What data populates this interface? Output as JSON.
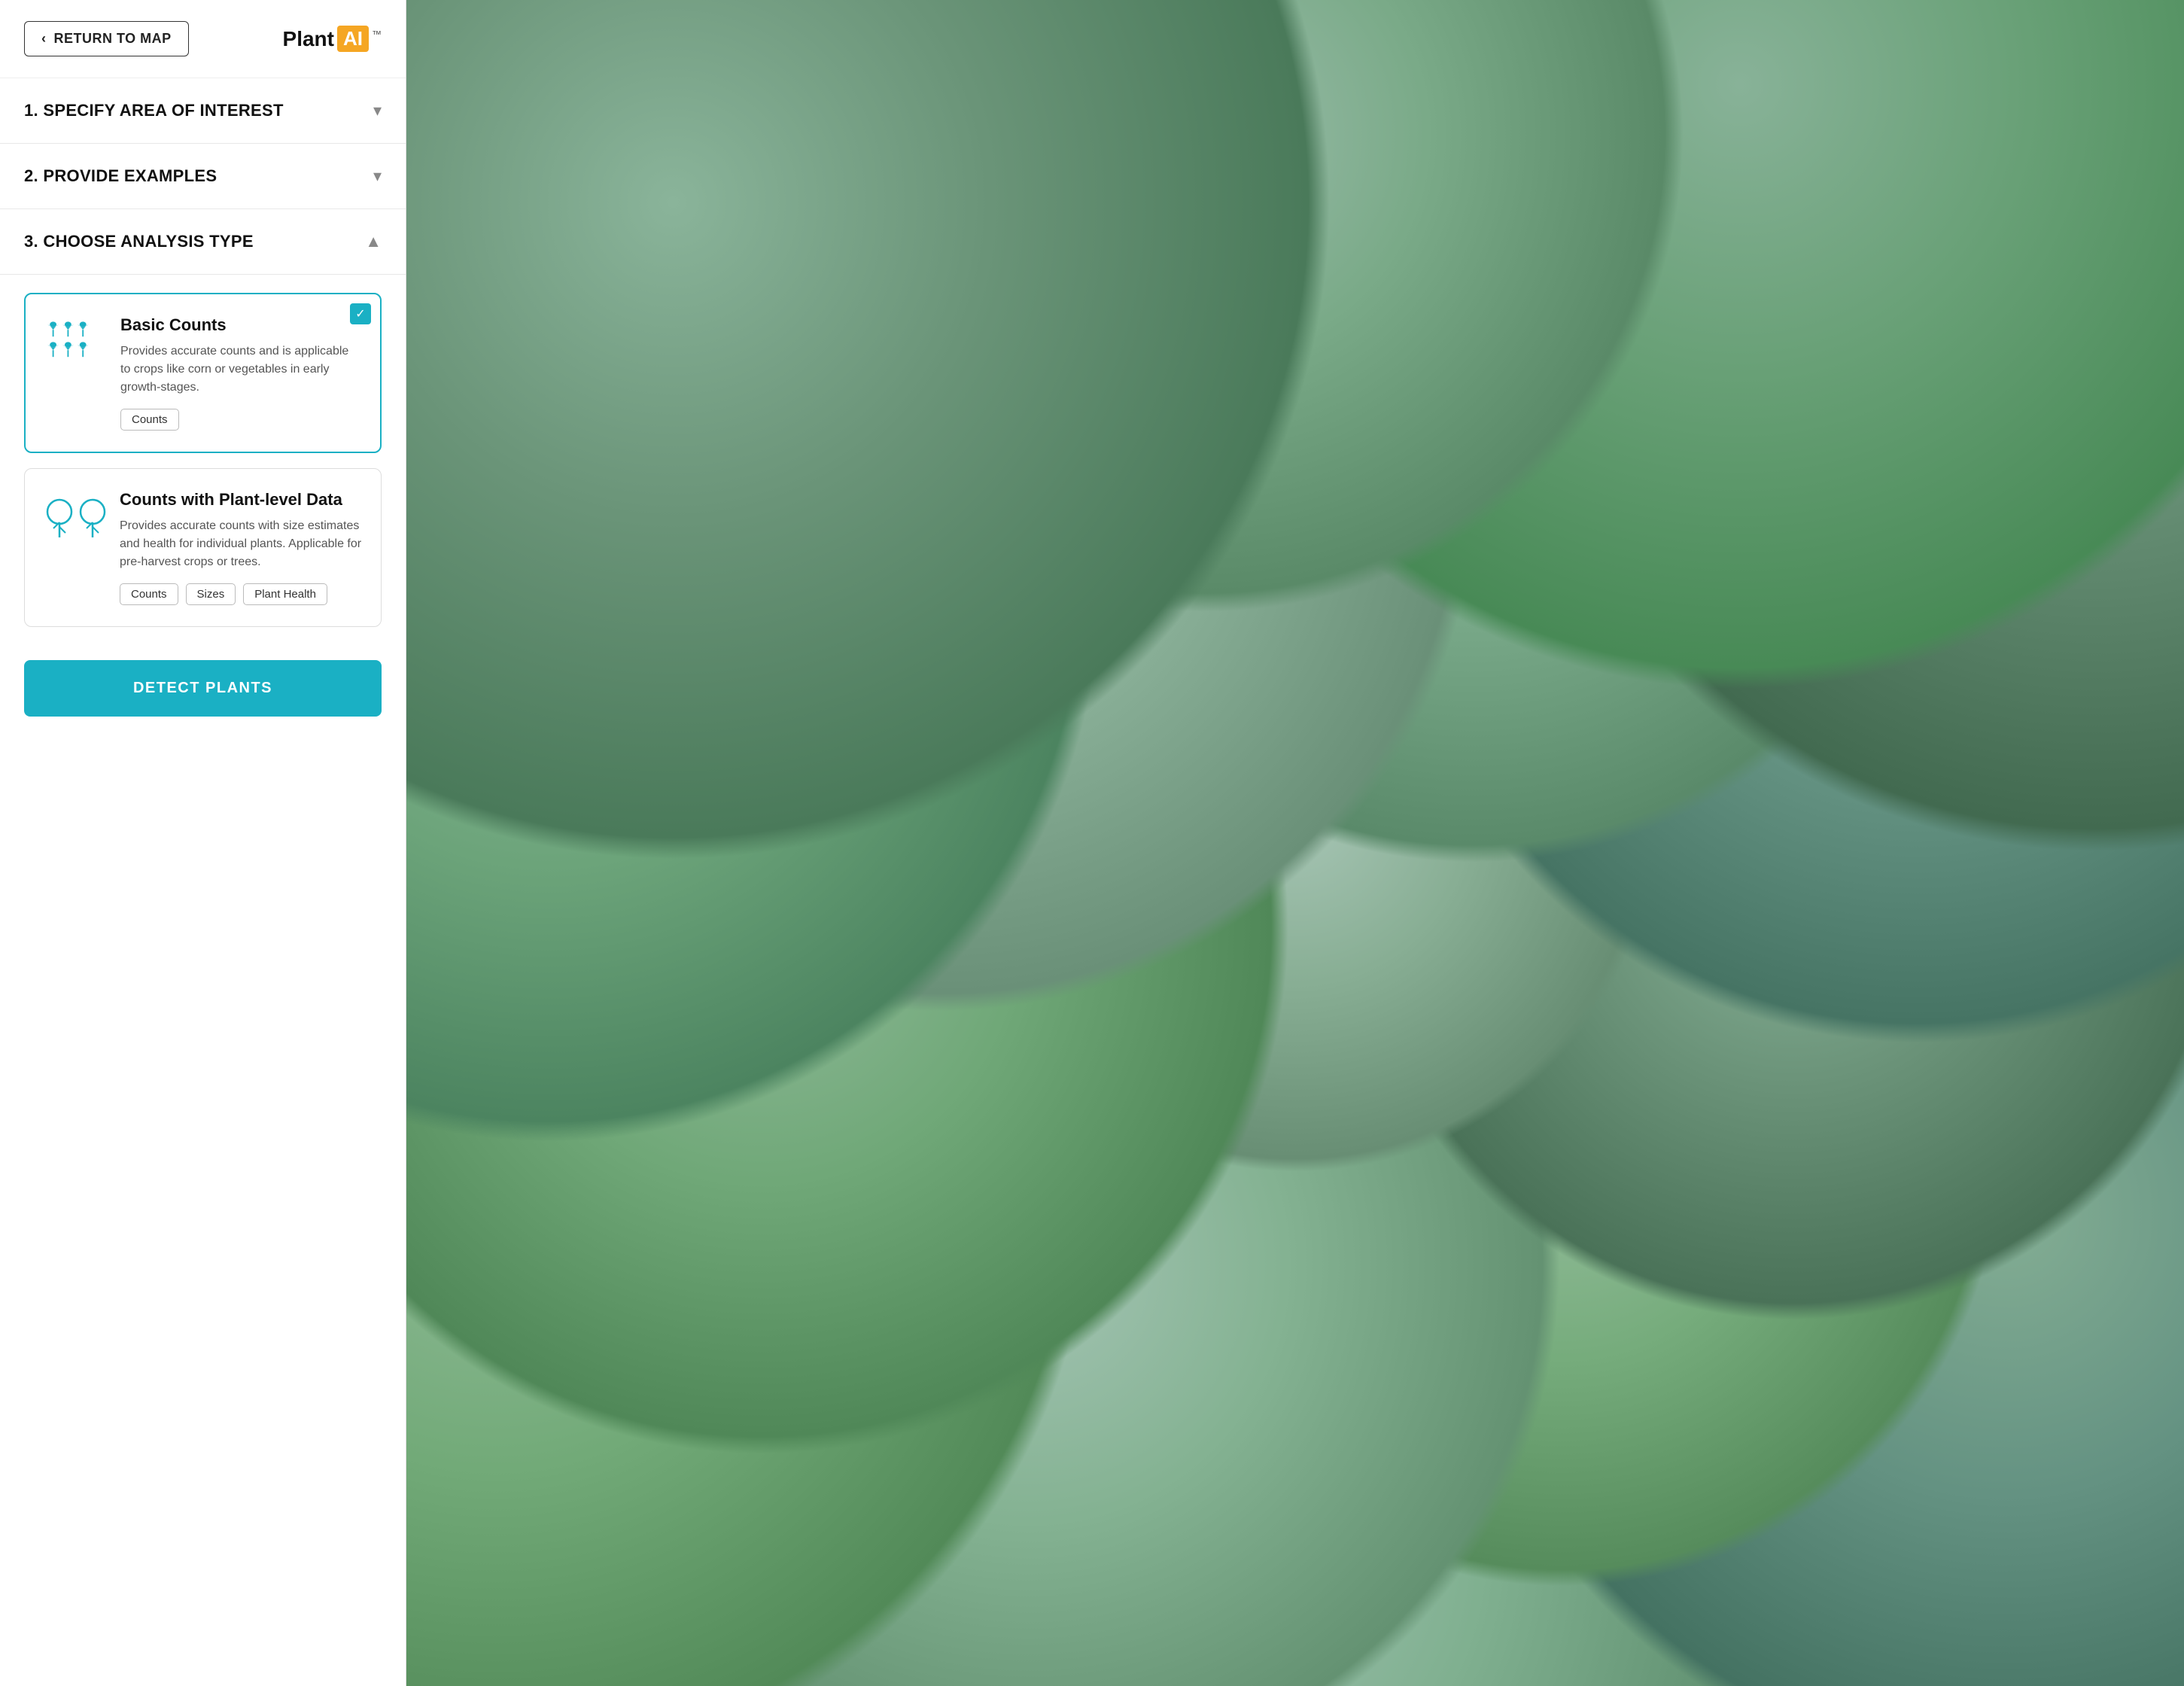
{
  "header": {
    "return_label": "RETURN TO MAP",
    "logo_plant": "Plant",
    "logo_ai": "AI",
    "logo_tm": "™"
  },
  "sections": {
    "section1": {
      "number": "1.",
      "title": "SPECIFY AREA OF INTEREST",
      "chevron": "▾",
      "expanded": false
    },
    "section2": {
      "number": "2.",
      "title": "PROVIDE EXAMPLES",
      "chevron": "▾",
      "expanded": false
    },
    "section3": {
      "number": "3.",
      "title": "CHOOSE ANALYSIS TYPE",
      "chevron": "▲",
      "expanded": true
    }
  },
  "cards": {
    "basic_counts": {
      "title": "Basic Counts",
      "description": "Provides accurate counts and is applicable to crops like corn or vegetables in early growth-stages.",
      "selected": true,
      "tags": [
        "Counts"
      ]
    },
    "plant_level": {
      "title": "Counts with Plant-level Data",
      "description": "Provides accurate counts with size estimates and health for individual plants. Applicable for pre-harvest crops or trees.",
      "selected": false,
      "tags": [
        "Counts",
        "Sizes",
        "Plant Health"
      ]
    }
  },
  "detect_btn": "DETECT PLANTS",
  "checkmark": "✓"
}
